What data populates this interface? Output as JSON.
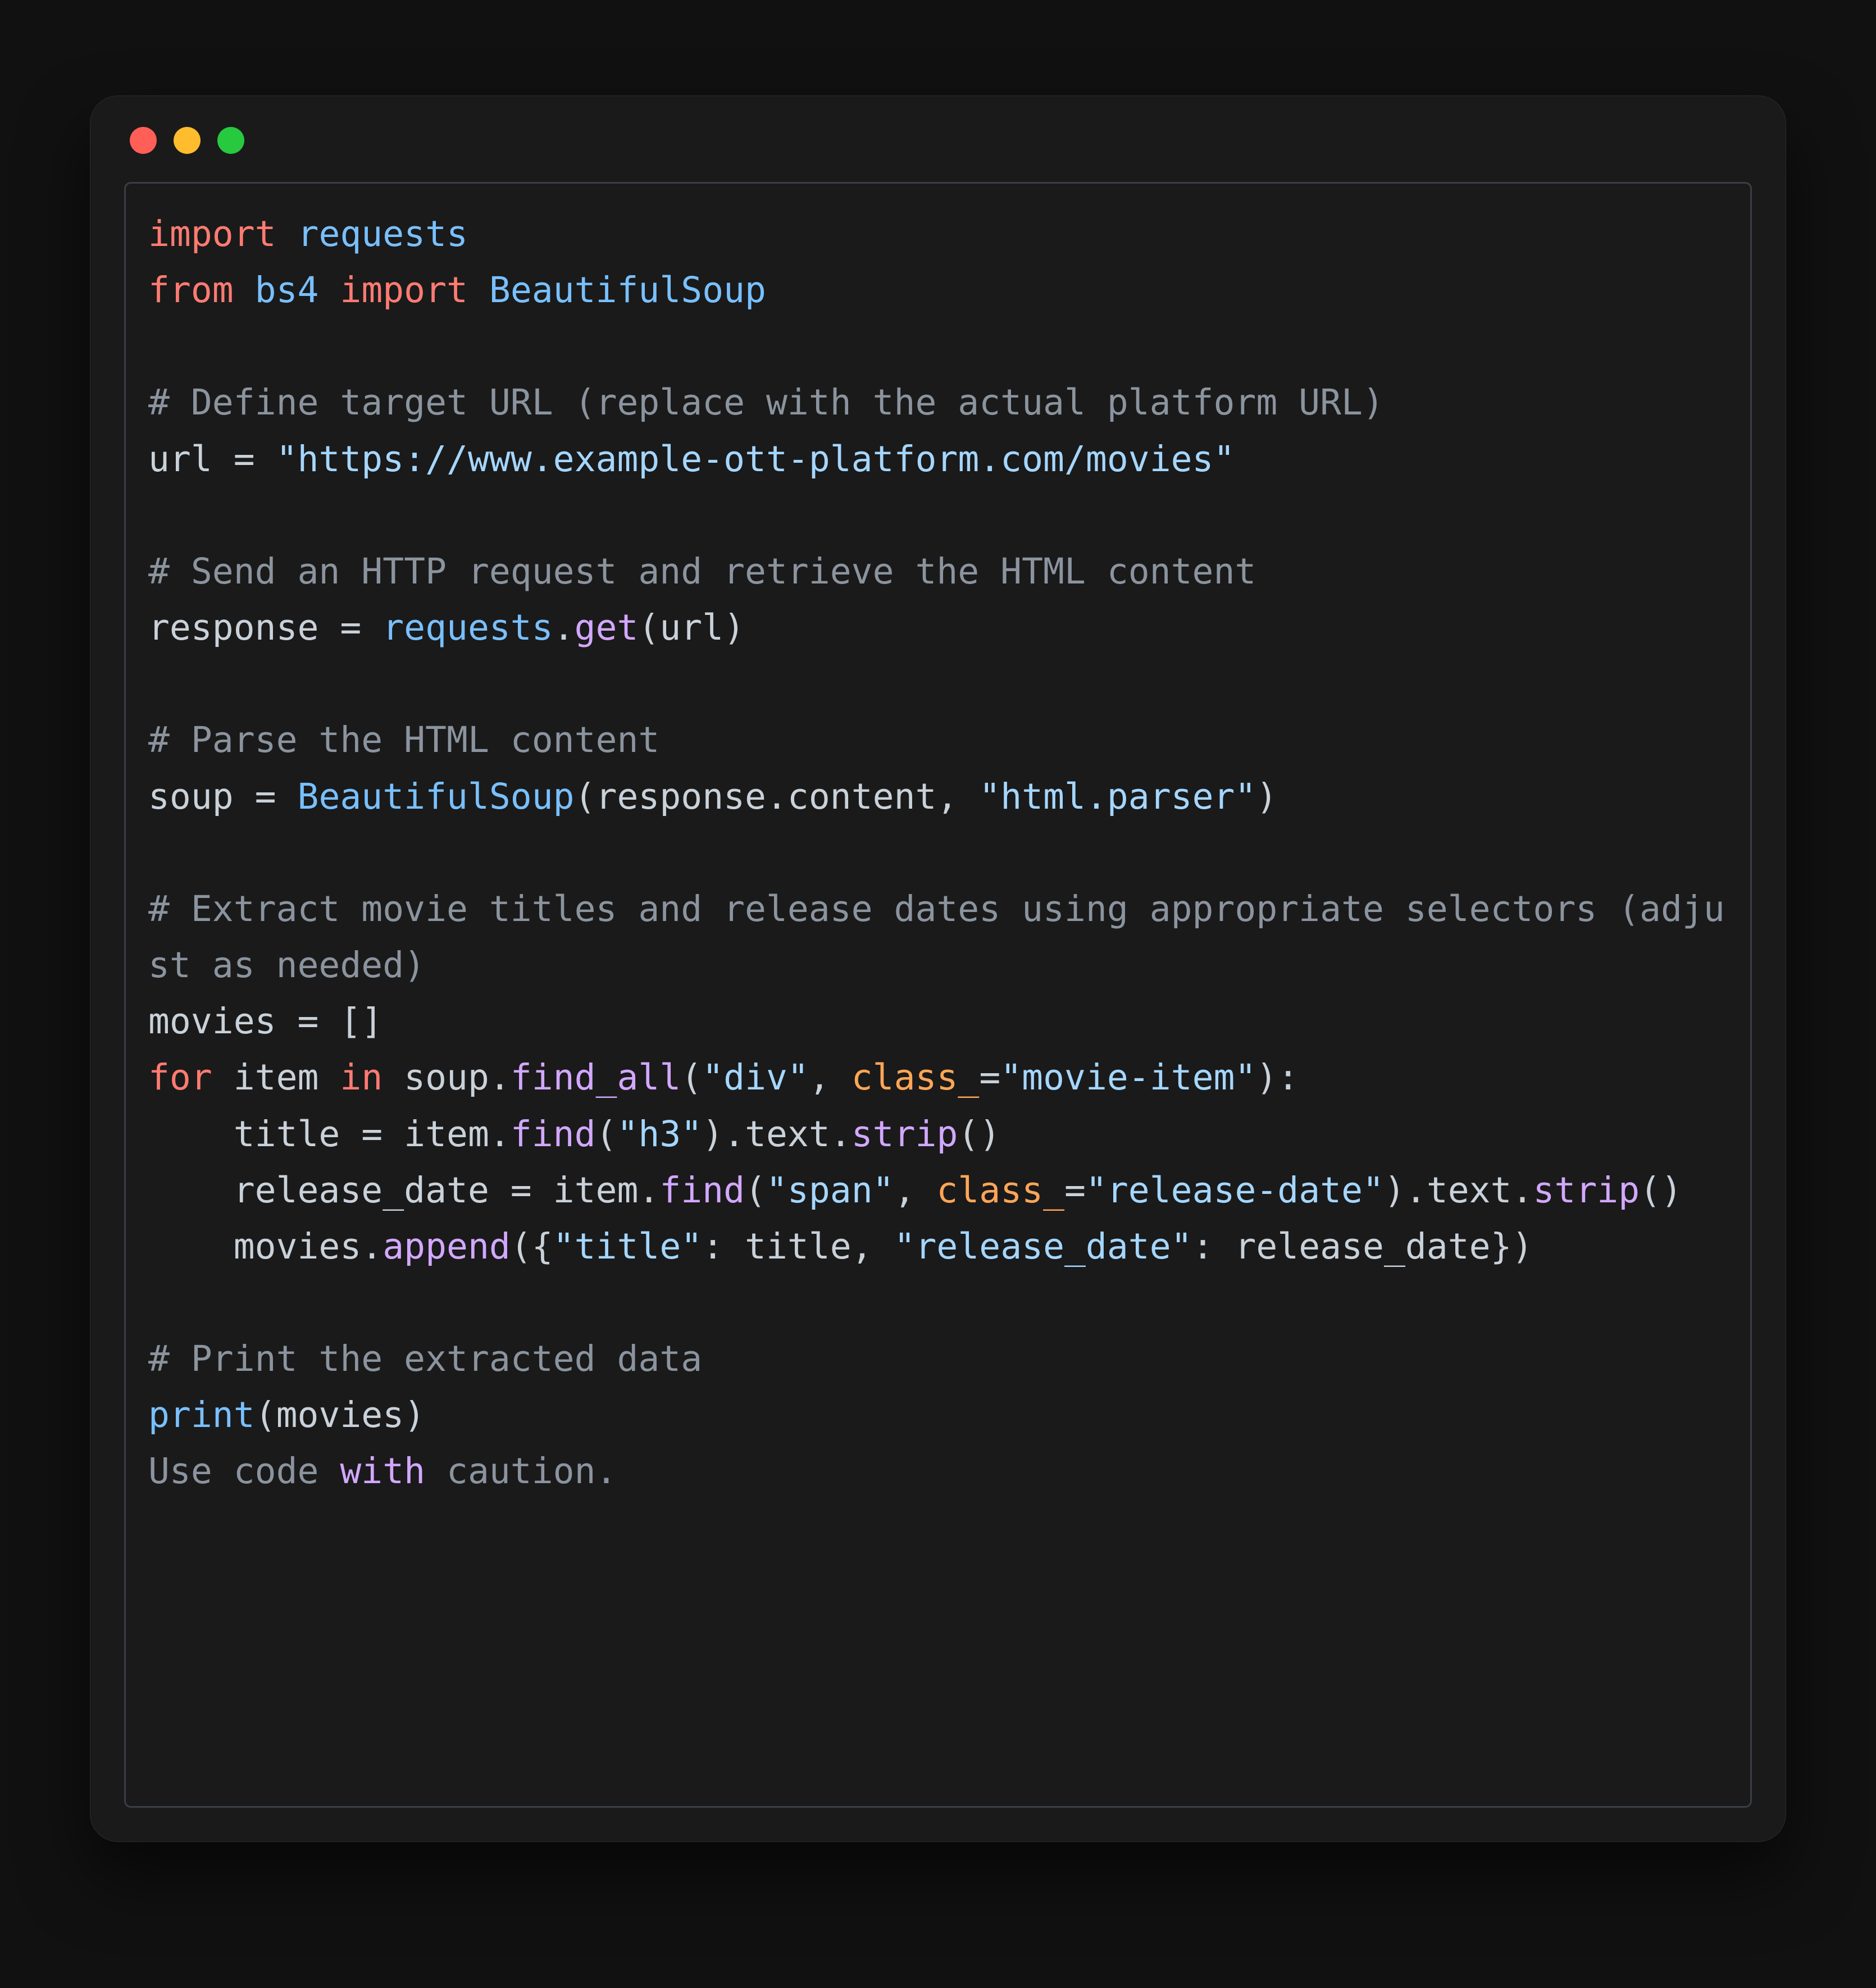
{
  "traffic_lights": [
    "close",
    "minimize",
    "zoom"
  ],
  "caution_text": {
    "prefix": "Use code ",
    "em": "with",
    "suffix": " caution."
  },
  "code": {
    "l01": {
      "kw_import": "import",
      "sp": " ",
      "mod": "requests"
    },
    "l02": {
      "kw_from": "from",
      "sp1": " ",
      "mod1": "bs4",
      "sp2": " ",
      "kw_import": "import",
      "sp3": " ",
      "mod2": "BeautifulSoup"
    },
    "l03": "",
    "l04": {
      "cmt": "# Define target URL (replace with the actual platform URL)"
    },
    "l05": {
      "var": "url",
      "op1": " = ",
      "str": "\"https://www.example-ott-platform.com/movies\""
    },
    "l06": "",
    "l07": {
      "cmt": "# Send an HTTP request and retrieve the HTML content"
    },
    "l08": {
      "var": "response",
      "op1": " = ",
      "obj": "requests",
      "dot": ".",
      "fn": "get",
      "lp": "(",
      "arg": "url",
      "rp": ")"
    },
    "l09": "",
    "l10": {
      "cmt": "# Parse the HTML content"
    },
    "l11": {
      "var": "soup",
      "op1": " = ",
      "cls": "BeautifulSoup",
      "lp": "(",
      "a1": "response",
      "d1": ".",
      "a1b": "content",
      "c": ", ",
      "str": "\"html.parser\"",
      "rp": ")"
    },
    "l12": "",
    "l13": {
      "cmt": "# Extract movie titles and release dates using appropriate selectors (adjust as needed)"
    },
    "l14": {
      "var": "movies",
      "op1": " = []"
    },
    "l15": {
      "kw_for": "for",
      "sp1": " ",
      "v": "item",
      "sp2": " ",
      "kw_in": "in",
      "sp3": " ",
      "obj": "soup",
      "dot": ".",
      "fn": "find_all",
      "lp": "(",
      "s1": "\"div\"",
      "c": ", ",
      "kwarg": "class_",
      "eq": "=",
      "s2": "\"movie-item\"",
      "rp": "):"
    },
    "l16": {
      "indent": "    ",
      "var": "title",
      "op1": " = ",
      "obj": "item",
      "dot": ".",
      "fn1": "find",
      "lp": "(",
      "s1": "\"h3\"",
      "rp": ")",
      "d2": ".",
      "p1": "text",
      "d3": ".",
      "fn2": "strip",
      "pp": "()"
    },
    "l17": {
      "indent": "    ",
      "var": "release_date",
      "op1": " = ",
      "obj": "item",
      "dot": ".",
      "fn1": "find",
      "lp": "(",
      "s1": "\"span\"",
      "c": ", ",
      "kwarg": "class_",
      "eq": "=",
      "s2": "\"release-date\"",
      "rp": ")",
      "d2": ".",
      "p1": "text",
      "d3": ".",
      "fn2": "strip",
      "pp": "()"
    },
    "l18": {
      "indent": "    ",
      "obj": "movies",
      "dot": ".",
      "fn": "append",
      "lp": "({",
      "k1": "\"title\"",
      "c1": ": ",
      "v1": "title",
      "c2": ", ",
      "k2": "\"release_date\"",
      "c3": ": ",
      "v2": "release_date",
      "rp": "})"
    },
    "l19": "",
    "l20": {
      "cmt": "# Print the extracted data"
    },
    "l21": {
      "fn": "print",
      "lp": "(",
      "arg": "movies",
      "rp": ")"
    }
  }
}
